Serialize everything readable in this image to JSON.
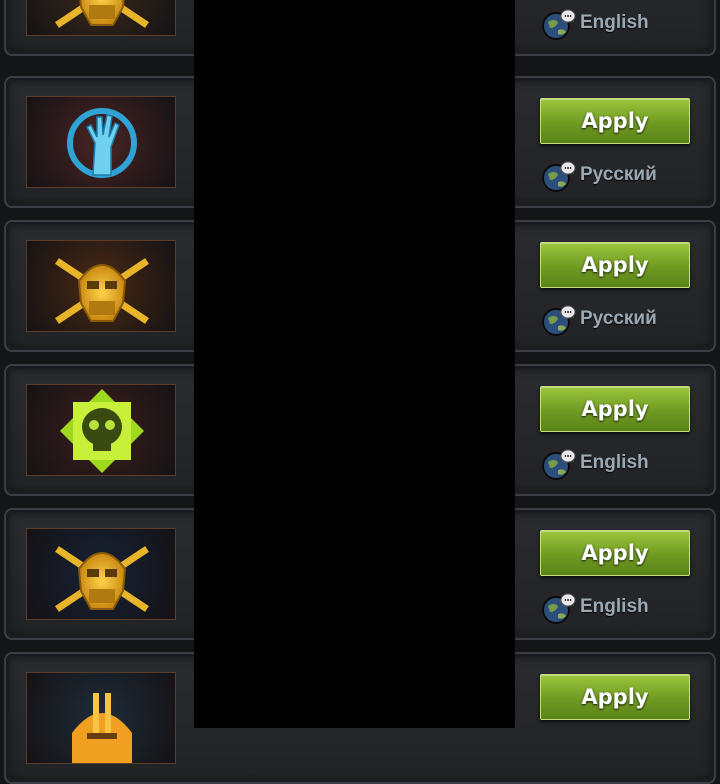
{
  "apply_label": "Apply",
  "cards": [
    {
      "emblem": "gold-robot-skull-emblem",
      "bg": "#3a2a1c",
      "language": "English",
      "has_apply": false
    },
    {
      "emblem": "blue-zombie-hand-emblem",
      "bg": "#4a2424",
      "language": "Русский",
      "has_apply": true
    },
    {
      "emblem": "gold-robot-skull-emblem",
      "bg": "#4a2a14",
      "language": "Русский",
      "has_apply": true
    },
    {
      "emblem": "green-gas-mask-skull-emblem",
      "bg": "#3c1f1c",
      "language": "English",
      "has_apply": true
    },
    {
      "emblem": "gold-robot-skull-emblem",
      "bg": "#162236",
      "language": "English",
      "has_apply": true
    },
    {
      "emblem": "orange-helmet-emblem",
      "bg": "#1f2c3a",
      "language": "",
      "has_apply": true
    }
  ],
  "colors": {
    "apply_green": "#7fa82a",
    "language_text": "#9aa9b4",
    "panel_black": "#000000"
  },
  "icons": {
    "globe": "globe-chat-icon"
  }
}
